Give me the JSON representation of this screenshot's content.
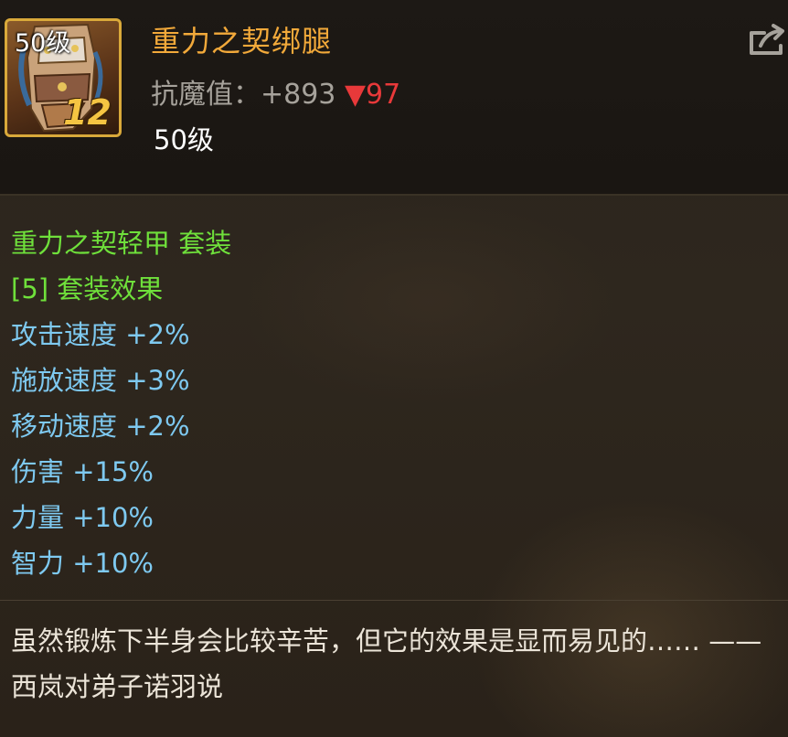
{
  "item": {
    "icon_level": "50级",
    "icon_number": "12",
    "icon_name": "leg-armor-icon",
    "name": "重力之契绑腿",
    "stat_label": "抗魔值：",
    "stat_value": "+893",
    "stat_diff_arrow": "▼",
    "stat_diff_value": "97",
    "level": "50级"
  },
  "set": {
    "name": "重力之契轻甲 套装",
    "bonus_header": "[5] 套装效果",
    "effects": [
      "攻击速度 +2%",
      "施放速度 +3%",
      "移动速度 +2%",
      "伤害 +15%",
      "力量 +10%",
      "智力 +10%"
    ]
  },
  "description": "虽然锻炼下半身会比较辛苦，但它的效果是显而易见的…… ——西岚对弟子诺羽说",
  "colors": {
    "name": "#f2a93a",
    "set_green": "#6fe03b",
    "effect_blue": "#7ec9f0",
    "stat_decrease_red": "#e8393a",
    "icon_border_gold": "#d9a93a"
  },
  "share_icon": "share-icon"
}
